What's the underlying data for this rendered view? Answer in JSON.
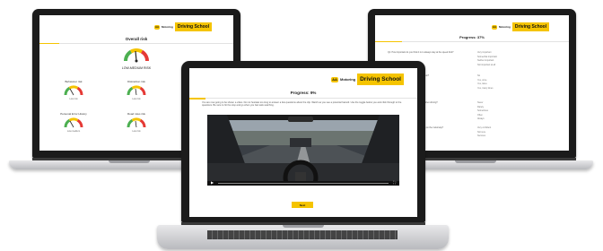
{
  "brand": {
    "aa_badge": "AA",
    "aa_text": "Motoring",
    "school": "Driving School",
    "accent": "#f5c400"
  },
  "left_screen": {
    "title": "Overall risk",
    "overall_label": "LOW-MEDIUM RISK",
    "gauges": [
      {
        "label": "Behaviour risk",
        "value": "Low risk"
      },
      {
        "label": "Distraction risk",
        "value": "Low risk"
      },
      {
        "label": "Low Experience risk",
        "value": "Medium risk"
      },
      {
        "label": "Personal Error History",
        "value": "Low-medium"
      },
      {
        "label": "Road rules risk",
        "value": "Low risk"
      },
      {
        "label": "Car knowledge risk",
        "value": "Low-medium"
      }
    ]
  },
  "center_screen": {
    "title": "Progress: 9%",
    "instructions": "You are now going to be shown a video. Do not hesitate too long to answer a few questions about the clip. Watch as you see a potential hazard. Use the toggle below you and click through to the questions. Be sure to hit the stop and go when you feel safe watching.",
    "button_label": "Next"
  },
  "right_screen": {
    "title": "Progress: 37%",
    "questions": [
      {
        "text": "Q1: How important do you think it is to always stay at the speed limit?",
        "options": [
          "Very important",
          "Somewhat important",
          "Neither important",
          "Not important at all"
        ]
      },
      {
        "text": "Q2: Have you ever experienced a collision?",
        "options": [
          "No",
          "Yes, once",
          "Yes, twice",
          "Yes, many times"
        ]
      },
      {
        "text": "Q3: How often do you use your phone when driving?",
        "options": [
          "Never",
          "Rarely",
          "Sometimes",
          "Often",
          "Always"
        ]
      },
      {
        "text": "Q4: How confident are you when driving on the motorway?",
        "options": [
          "Very confident",
          "Not sure",
          "Nervous"
        ]
      }
    ]
  }
}
